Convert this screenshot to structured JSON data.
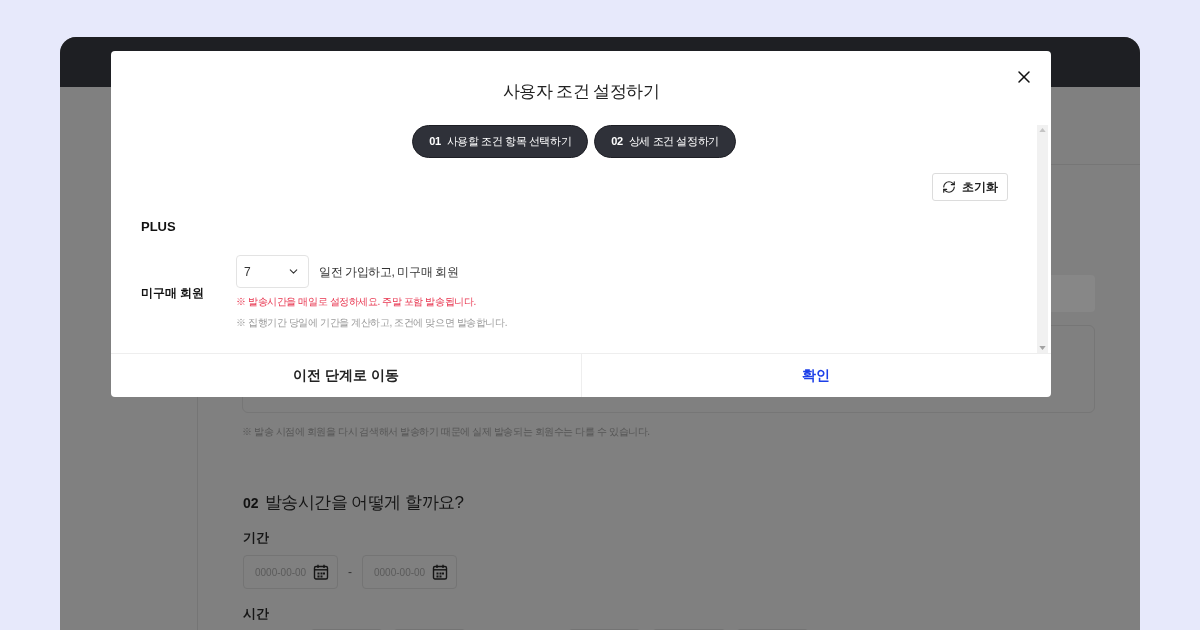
{
  "page": {
    "notice": "※ 발송 시점에 회원을 다시 검색해서 발송하기 때문에 실제 발송되는 회원수는 다를 수 있습니다.",
    "section": {
      "number": "02",
      "title": "발송시간을 어떻게 할까요?"
    },
    "period": {
      "label": "기간",
      "start": {
        "placeholder": "0000-00-00"
      },
      "separator": "-",
      "end": {
        "placeholder": "0000-00-00"
      }
    },
    "time": {
      "label": "시간"
    }
  },
  "modal": {
    "title": "사용자 조건 설정하기",
    "steps": [
      {
        "number": "01",
        "label": "사용할 조건 항목 선택하기"
      },
      {
        "number": "02",
        "label": "상세 조건 설정하기"
      }
    ],
    "reset_button": "초기화",
    "group_title": "PLUS",
    "condition": {
      "label": "미구매 회원",
      "select": {
        "value": "7"
      },
      "suffix": "일전 가입하고, 미구매 회원",
      "notes": [
        {
          "kind": "warning",
          "text": "※ 발송시간을 매일로 설정하세요. 주말 포함 발송됩니다."
        },
        {
          "kind": "info",
          "text": "※ 집행기간 당일에 기간을 계산하고, 조건에 맞으면 발송합니다."
        }
      ]
    },
    "buttons": [
      {
        "kind": "secondary",
        "label": "이전 단계로 이동"
      },
      {
        "kind": "primary",
        "label": "확인"
      }
    ]
  }
}
